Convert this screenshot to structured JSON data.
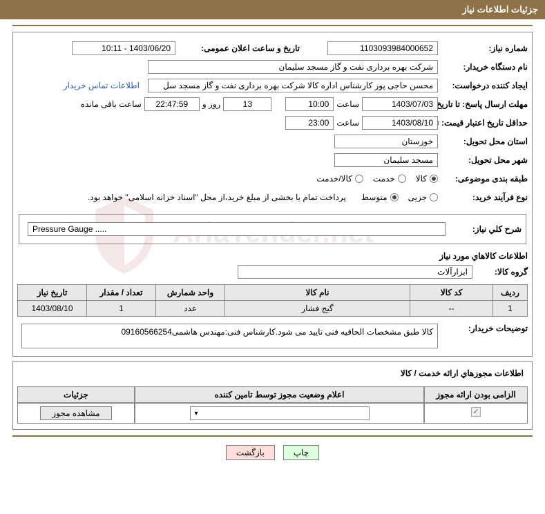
{
  "header": {
    "title": "جزئیات اطلاعات نیاز"
  },
  "need_no": {
    "label": "شماره نیاز:",
    "value": "1103093984000652"
  },
  "announce": {
    "label": "تاریخ و ساعت اعلان عمومی:",
    "value": "1403/06/20 - 10:11"
  },
  "buyer_org": {
    "label": "نام دستگاه خریدار:",
    "value": "شرکت بهره برداری نفت و گاز مسجد سلیمان"
  },
  "requester": {
    "label": "ایجاد کننده درخواست:",
    "value": "محسن حاجی پور کارشناس اداره کالا   شرکت بهره برداری نفت و گاز مسجد سل",
    "contact_link": "اطلاعات تماس خریدار"
  },
  "deadline": {
    "label": "مهلت ارسال پاسخ: تا تاریخ:",
    "date": "1403/07/03",
    "time_label": "ساعت",
    "time": "10:00",
    "days": "13",
    "days_label": "روز و",
    "hms": "22:47:59",
    "remain_label": "ساعت باقی مانده"
  },
  "validity": {
    "label": "حداقل تاریخ اعتبار قیمت: تا تاریخ:",
    "date": "1403/08/10",
    "time_label": "ساعت",
    "time": "23:00"
  },
  "province": {
    "label": "استان محل تحویل:",
    "value": "خوزستان"
  },
  "city": {
    "label": "شهر محل تحویل:",
    "value": "مسجد سلیمان"
  },
  "category": {
    "label": "طبقه بندی موضوعی:",
    "opts": [
      "کالا",
      "خدمت",
      "کالا/خدمت"
    ],
    "selected": 0
  },
  "purchase_type": {
    "label": "نوع فرآیند خرید:",
    "opts": [
      "جزیی",
      "متوسط"
    ],
    "selected": 1,
    "note": "پرداخت تمام یا بخشی از مبلغ خرید،از محل \"اسناد خزانه اسلامی\" خواهد بود."
  },
  "summary": {
    "label": "شرح کلي نیاز:",
    "value": "Pressure Gauge ....."
  },
  "goods_section_title": "اطلاعات کالاهاي مورد نیاز",
  "goods_group": {
    "label": "گروه کالا:",
    "value": "ابزارآلات"
  },
  "table": {
    "headers": [
      "ردیف",
      "کد کالا",
      "نام کالا",
      "واحد شمارش",
      "تعداد / مقدار",
      "تاریخ نیاز"
    ],
    "rows": [
      [
        "1",
        "--",
        "گیج فشار",
        "عدد",
        "1",
        "1403/08/10"
      ]
    ]
  },
  "buyer_desc": {
    "label": "توضیحات خریدار:",
    "value": "کالا طبق مشخصات الحاقیه فنی تایید می شود.کارشناس فنی:مهندس هاشمی09160566254"
  },
  "license_section_title": "اطلاعات مجوزهاي ارائه خدمت / کالا",
  "license_table": {
    "headers": [
      "الزامی بودن ارائه مجوز",
      "اعلام وضعیت مجوز توسط تامین کننده",
      "جزئیات"
    ],
    "mandatory_checked": true,
    "select_value": "",
    "view_btn": "مشاهده مجوز"
  },
  "footer": {
    "print": "چاپ",
    "back": "بازگشت"
  },
  "watermark_text": "AriaTender.net"
}
